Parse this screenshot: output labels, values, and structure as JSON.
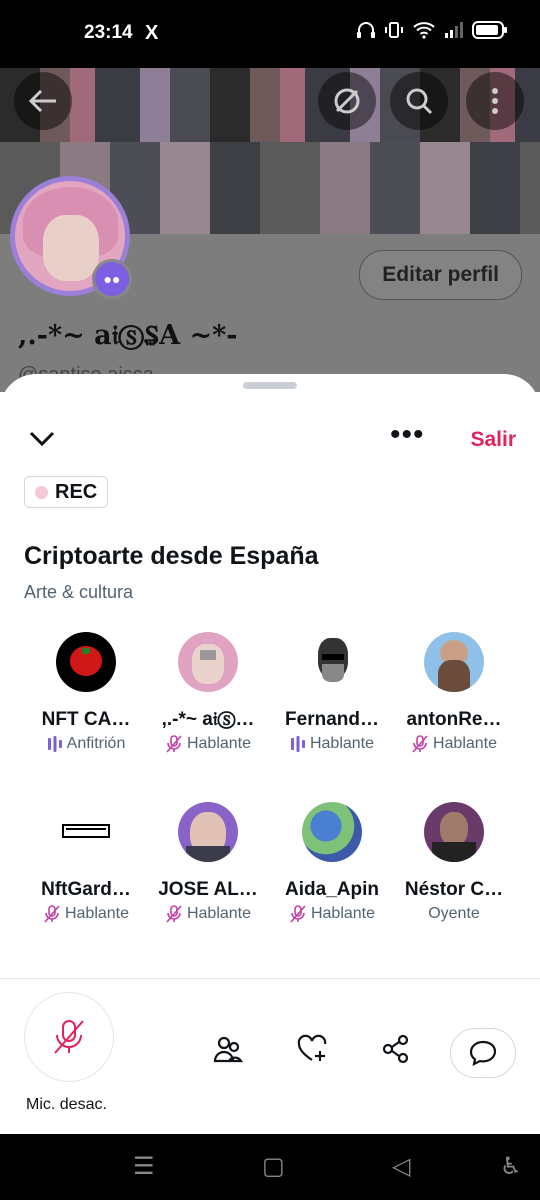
{
  "status_bar": {
    "time": "23:14",
    "app_logo": "X"
  },
  "profile": {
    "name": ",.-*~ a𝔦Ⓢ₷A ~*-",
    "handle": "@santiso.aissa",
    "edit_button": "Editar perfil"
  },
  "space": {
    "more_label": "•••",
    "leave_label": "Salir",
    "rec_label": "REC",
    "title": "Criptoarte desde España",
    "category": "Arte & cultura",
    "participants": [
      {
        "name": "NFT CA…",
        "role": "Anfitrión",
        "role_icon": "speaking-bars-icon"
      },
      {
        "name": ",.-*~ a𝔦Ⓢ…",
        "role": "Hablante",
        "role_icon": "mic-off-icon"
      },
      {
        "name": "Fernand…",
        "role": "Hablante",
        "role_icon": "speaking-bars-icon"
      },
      {
        "name": "antonRe…",
        "role": "Hablante",
        "role_icon": "mic-off-icon"
      },
      {
        "name": "NftGard…",
        "role": "Hablante",
        "role_icon": "mic-off-icon"
      },
      {
        "name": "JOSE AL…",
        "role": "Hablante",
        "role_icon": "mic-off-icon"
      },
      {
        "name": "Aida_Apin",
        "role": "Hablante",
        "role_icon": "mic-off-icon"
      },
      {
        "name": "Néstor C…",
        "role": "Oyente",
        "role_icon": ""
      }
    ],
    "mic_label": "Mic. desac."
  },
  "colors": {
    "accent_red": "#e0245e",
    "purple": "#7b5fe0",
    "text_secondary": "#536471"
  }
}
